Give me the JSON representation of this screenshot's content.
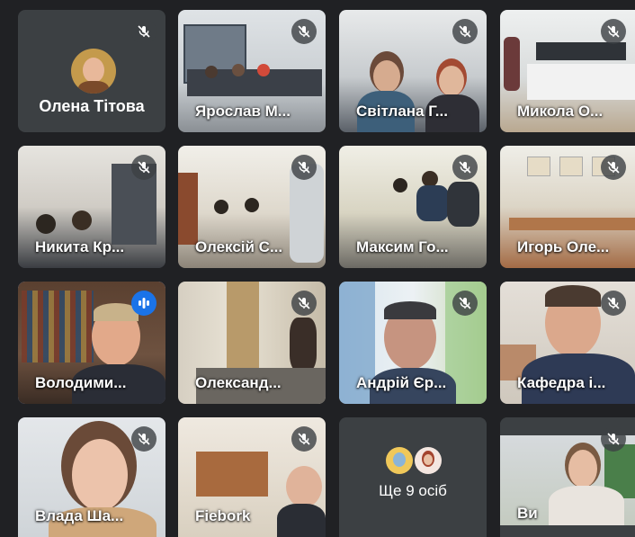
{
  "tiles": [
    {
      "name": "Олена Тітова",
      "muted": true,
      "type": "avatar"
    },
    {
      "name": "Ярослав М...",
      "muted": true
    },
    {
      "name": "Світлана Г...",
      "muted": true
    },
    {
      "name": "Микола О...",
      "muted": true
    },
    {
      "name": "Никита Кр...",
      "muted": true
    },
    {
      "name": "Олексій С...",
      "muted": true
    },
    {
      "name": "Максим Го...",
      "muted": true
    },
    {
      "name": "Игорь Оле...",
      "muted": true
    },
    {
      "name": "Володими...",
      "muted": false,
      "speaking": true
    },
    {
      "name": "Олександ...",
      "muted": true
    },
    {
      "name": "Андрій Єр...",
      "muted": true
    },
    {
      "name": "Кафедра і...",
      "muted": true
    },
    {
      "name": "Влада Ша...",
      "muted": true
    },
    {
      "name": "Fiebork",
      "muted": true
    },
    {
      "name": "",
      "type": "more",
      "more_text": "Ще 9 осіб"
    },
    {
      "name": "Ви",
      "muted": true
    }
  ],
  "colors": {
    "background": "#202124",
    "tile": "#3c4043",
    "speaking_accent": "#1a73e8",
    "active_border": "#8ab4f8"
  },
  "icons": {
    "muted": "mic-off-icon",
    "speaking": "audio-level-icon"
  }
}
